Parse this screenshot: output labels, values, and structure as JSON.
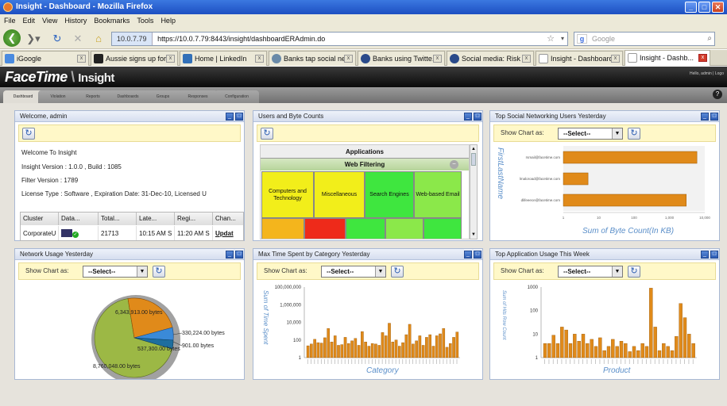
{
  "window": {
    "title": "Insight - Dashboard - Mozilla Firefox"
  },
  "menu": [
    "File",
    "Edit",
    "View",
    "History",
    "Bookmarks",
    "Tools",
    "Help"
  ],
  "url": {
    "site": "10.0.7.79",
    "address": "https://10.0.7.79:8443/insight/dashboardERAdmin.do"
  },
  "search": {
    "placeholder": "Google"
  },
  "tabs": [
    {
      "label": "iGoogle"
    },
    {
      "label": "Aussie signs up for..."
    },
    {
      "label": "Home | LinkedIn"
    },
    {
      "label": "Banks tap social ne..."
    },
    {
      "label": "Banks using Twitte..."
    },
    {
      "label": "Social media: Risk ..."
    },
    {
      "label": "Insight - Dashboard"
    },
    {
      "label": "Insight - Dashb..."
    }
  ],
  "app": {
    "brand": "FaceTime",
    "product": "Insight",
    "user": "Hello, admin | Logo",
    "nav": [
      "Dashboard",
      "Violation",
      "Reports",
      "Dashboards",
      "Groups",
      "Responses",
      "Configuration"
    ]
  },
  "show_chart_label": "Show Chart as:",
  "select_label": "--Select--",
  "welcome": {
    "title": "Welcome, admin",
    "lines": [
      "Welcome To Insight",
      "Insight Version :   1.0.0 , Build : 1085",
      "Filter Version :    1789",
      "License Type :     Software , Expiration Date: 31-Dec-10, Licensed U"
    ],
    "grid_headers": [
      "Cluster",
      "Data...",
      "Total...",
      "Late...",
      "Regi...",
      "Chan..."
    ],
    "grid_row": [
      "CorporateU",
      "",
      "21713",
      "10:15 AM S",
      "11:20 AM S",
      "Updat"
    ]
  },
  "users_bytes": {
    "title": "Users and Byte Counts",
    "applications_label": "Applications",
    "webfilter_label": "Web Filtering",
    "cells": [
      "Computers and Technology",
      "Miscellaneous",
      "Search Engines",
      "Web-based Email"
    ],
    "colors": {
      "yellow": "#f2ee1a",
      "green": "#3fe63f",
      "lightgreen": "#8be84a",
      "red": "#ee2a1a",
      "orange": "#f4b51c"
    }
  },
  "social": {
    "title": "Top Social Networking Users Yesterday",
    "ylabel": "FirstLastName",
    "xlabel": "Sum of  Byte Count(In KB)",
    "users": [
      "rsmail@facetime.com",
      "lmaloroad@facetime.com",
      "dlifeeece@facetime.com"
    ],
    "xticks": [
      "1",
      "10",
      "100",
      "1,000",
      "10,000"
    ],
    "values": [
      6000,
      5,
      3000
    ],
    "color": "#e08a1a"
  },
  "network": {
    "title": "Network Usage Yesterday",
    "labels": [
      "6,343,913.00 bytes",
      "537,300.00 bytes",
      "330,224.00 bytes",
      "901.00 bytes",
      "8,760,048.00 bytes"
    ],
    "colors": {
      "orange": "#e08a1a",
      "olive": "#9cb845",
      "blue": "#3a8ad8",
      "teal": "#1e6e9e",
      "white": "#ffffff"
    }
  },
  "maxtime": {
    "title": "Max Time Spent by Category Yesterday",
    "ylabel": "Sum of  Time Spent",
    "xlabel": "Category",
    "yticks": [
      "100,000,000",
      "1,000,000",
      "10,000",
      "100",
      "1"
    ],
    "bars": [
      22,
      35,
      120,
      50,
      45,
      180,
      2000,
      60,
      300,
      25,
      30,
      200,
      40,
      80,
      150,
      25,
      900,
      60,
      20,
      40,
      35,
      25,
      700,
      300,
      8000,
      60,
      100,
      20,
      50,
      400,
      6000,
      35,
      80,
      300,
      25,
      200,
      400,
      20,
      300,
      500,
      2000,
      15,
      40,
      200,
      800
    ]
  },
  "topapp": {
    "title": "Top Application Usage This Week",
    "ylabel": "Sum of Hits Row Count",
    "xlabel": "Product",
    "yticks": [
      "1000",
      "100",
      "10",
      "1"
    ],
    "bars": [
      4,
      4,
      9,
      4,
      20,
      15,
      4,
      10,
      5,
      10,
      4,
      6,
      3,
      7,
      2,
      3,
      6,
      3,
      5,
      4,
      1.8,
      3,
      2,
      4,
      3,
      900,
      20,
      2,
      4,
      3,
      2,
      8,
      200,
      50,
      10,
      4
    ]
  }
}
